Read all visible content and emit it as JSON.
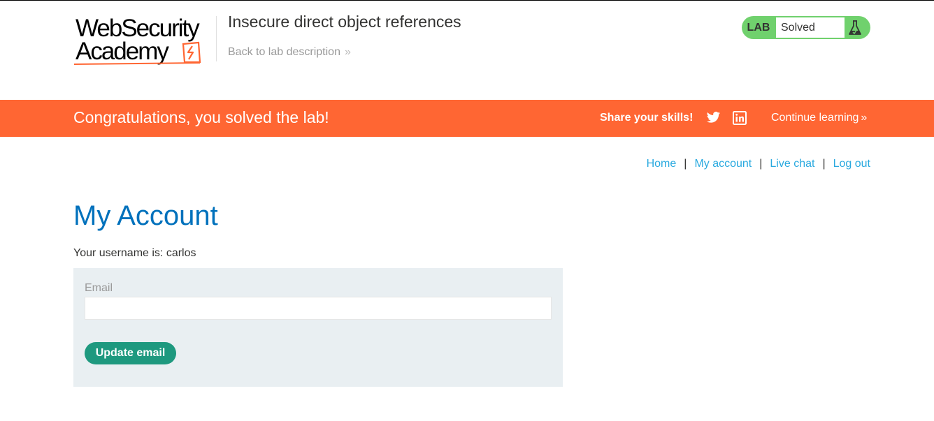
{
  "header": {
    "logo_line1": "WebSecurity",
    "logo_line2": "Academy",
    "lab_title": "Insecure direct object references",
    "back_link": "Back to lab description",
    "back_chevrons": "»",
    "lab_badge_label": "LAB",
    "lab_badge_status": "Solved"
  },
  "banner": {
    "message": "Congratulations, you solved the lab!",
    "share_label": "Share your skills!",
    "continue_label": "Continue learning",
    "continue_chevrons": "»"
  },
  "nav": {
    "items": [
      "Home",
      "My account",
      "Live chat",
      "Log out"
    ],
    "separator": "|"
  },
  "main": {
    "page_title": "My Account",
    "username_text": "Your username is: carlos",
    "email_label": "Email",
    "email_value": "",
    "update_button": "Update email"
  },
  "colors": {
    "accent_orange": "#ff6633",
    "badge_green": "#70d16d",
    "link_blue": "#29a9df",
    "title_blue": "#0071bc",
    "button_teal": "#1e997f",
    "panel_bg": "#e9eff2"
  },
  "icons": {
    "logo_mark": "academy-lightning-icon",
    "lab_icon": "flask-icon",
    "social": [
      "twitter-icon",
      "linkedin-icon"
    ]
  }
}
